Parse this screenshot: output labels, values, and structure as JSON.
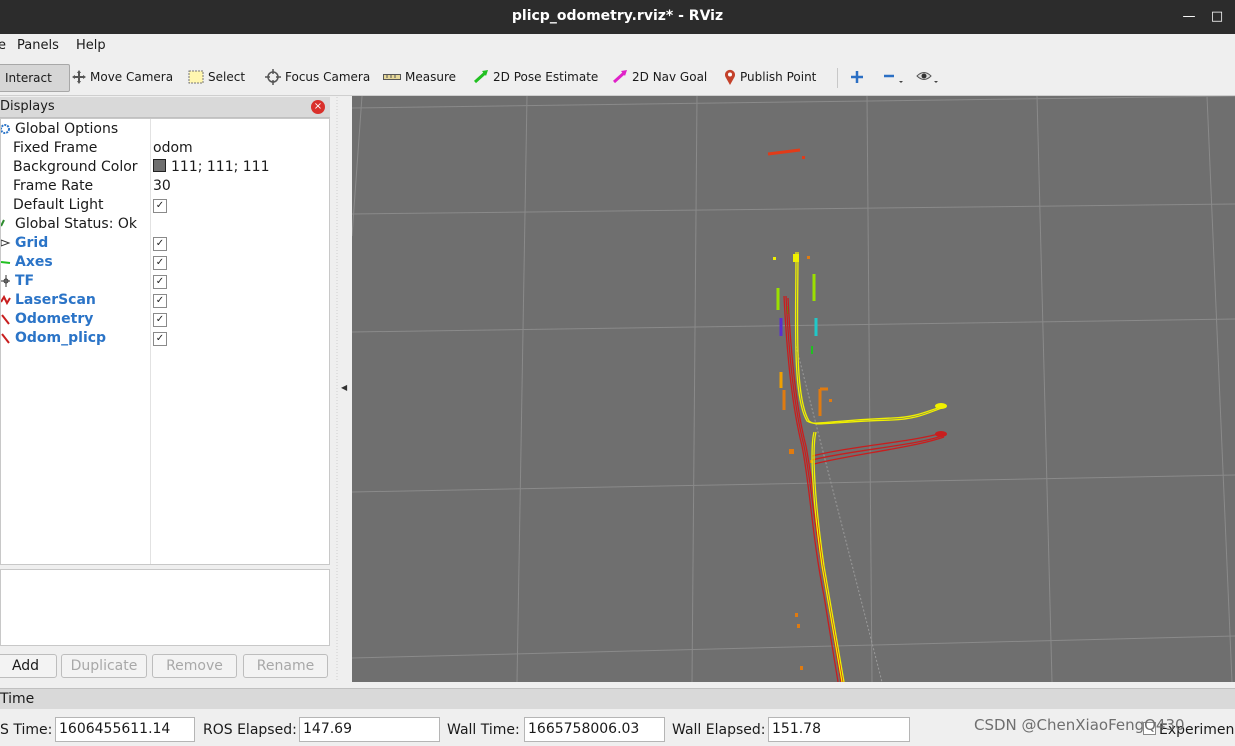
{
  "window": {
    "title": "plicp_odometry.rviz* - RViz",
    "minimize": "—",
    "maximize": "□"
  },
  "menu": {
    "items": [
      "e",
      "Panels",
      "Help"
    ]
  },
  "toolbar": {
    "tools": [
      "Interact",
      "Move Camera",
      "Select",
      "Focus Camera",
      "Measure",
      "2D Pose Estimate",
      "2D Nav Goal",
      "Publish Point"
    ],
    "active": "Interact"
  },
  "displays": {
    "title": "Displays",
    "global_options": "Global Options",
    "fixed_frame": {
      "label": "Fixed Frame",
      "value": "odom"
    },
    "background_color": {
      "label": "Background Color",
      "value": "111; 111; 111",
      "swatch": "#6f6f6f"
    },
    "frame_rate": {
      "label": "Frame Rate",
      "value": "30"
    },
    "default_light": {
      "label": "Default Light",
      "check": "✓"
    },
    "global_status": "Global Status: Ok",
    "items": [
      {
        "label": "Grid",
        "check": "✓"
      },
      {
        "label": "Axes",
        "check": "✓"
      },
      {
        "label": "TF",
        "check": "✓"
      },
      {
        "label": "LaserScan",
        "check": "✓"
      },
      {
        "label": "Odometry",
        "check": "✓"
      },
      {
        "label": "Odom_plicp",
        "check": "✓"
      }
    ],
    "buttons": {
      "add": "Add",
      "duplicate": "Duplicate",
      "remove": "Remove",
      "rename": "Rename"
    }
  },
  "time": {
    "title": "Time",
    "ros_time_label": "S Time:",
    "ros_time": "1606455611.14",
    "ros_elapsed_label": "ROS Elapsed:",
    "ros_elapsed": "147.69",
    "wall_time_label": "Wall Time:",
    "wall_time": "1665758006.03",
    "wall_elapsed_label": "Wall Elapsed:",
    "wall_elapsed": "151.78",
    "experimental": "Experimen"
  },
  "watermark": "CSDN @ChenXiaoFengQ430",
  "colors": {
    "viewport_bg": "#6f6f6f",
    "path_yellow": "#f0f000",
    "path_red": "#c81e1e",
    "link_blue": "#2b74c7"
  },
  "icons": {
    "close": "×",
    "check": "✓",
    "collapse_arrow": "◀"
  }
}
